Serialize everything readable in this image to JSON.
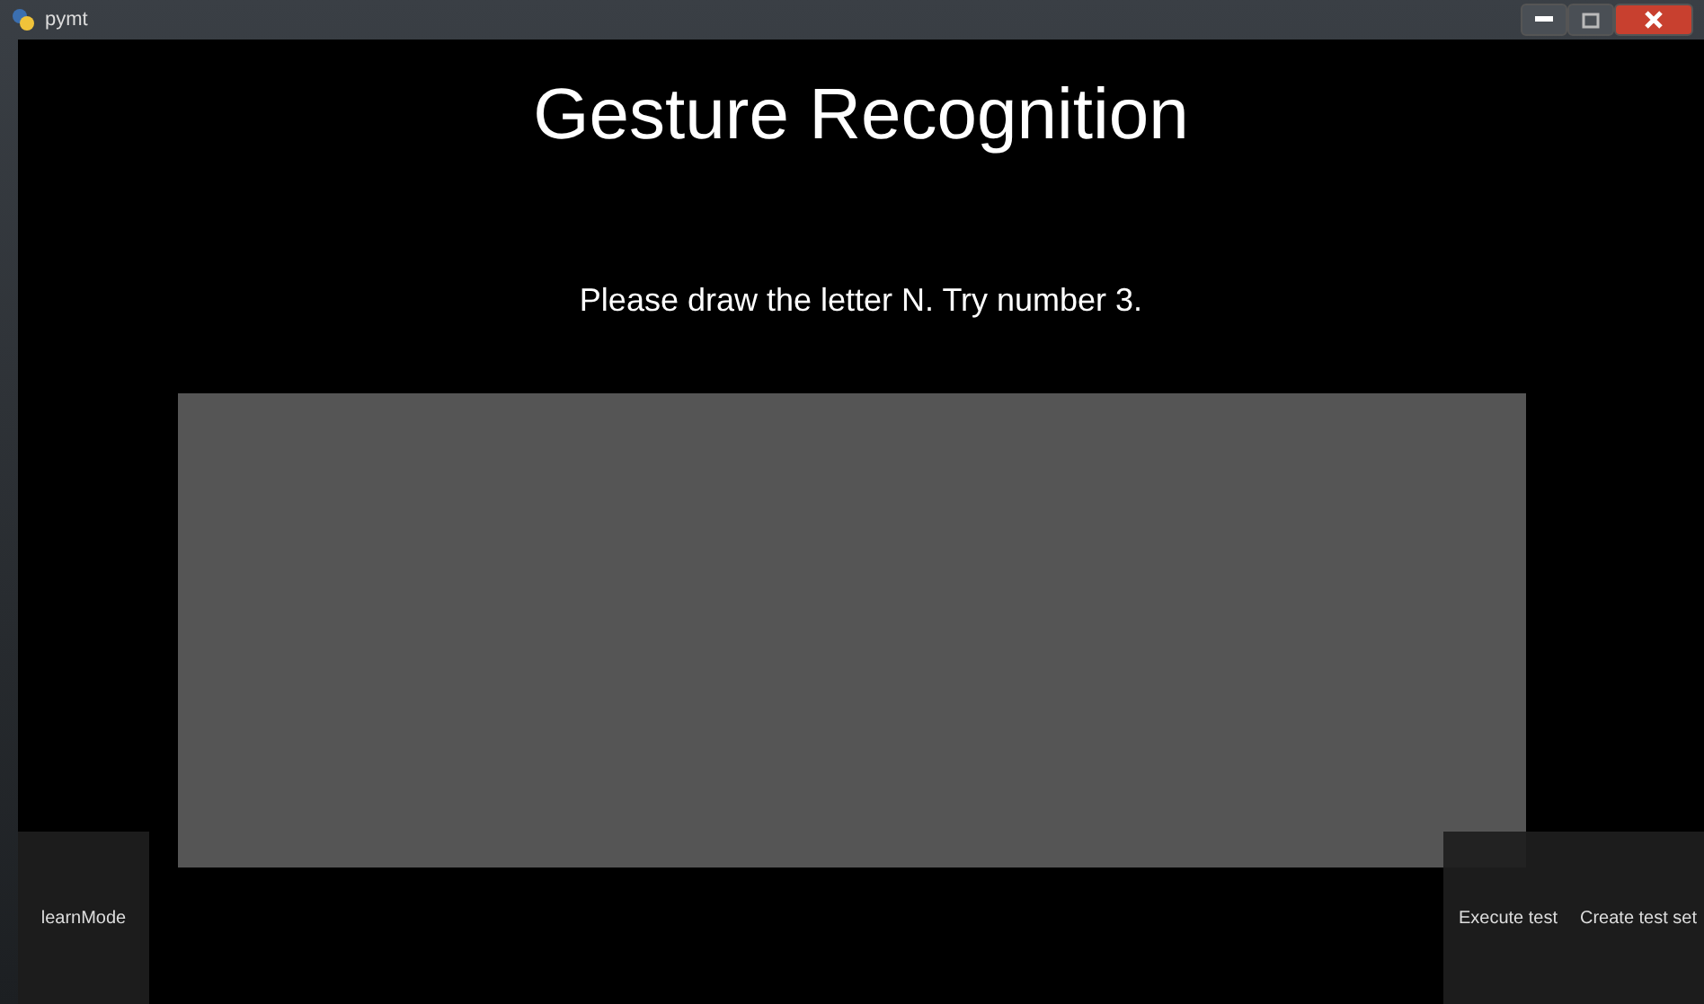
{
  "window": {
    "title": "pymt"
  },
  "heading": "Gesture Recognition",
  "instruction": "Please draw the letter N. Try number 3.",
  "buttons_left": [
    {
      "label": "learnMode"
    }
  ],
  "buttons_right": [
    {
      "label": "Execute test"
    },
    {
      "label": "Create test set"
    }
  ]
}
